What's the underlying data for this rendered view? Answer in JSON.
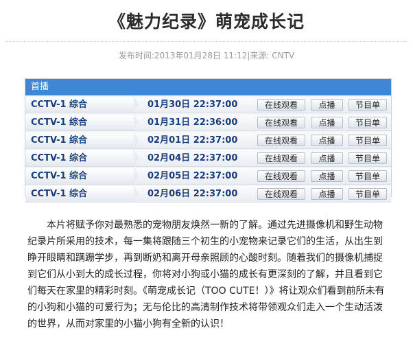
{
  "article": {
    "title": "《魅力纪录》萌宠成长记",
    "meta": "发布时间:2013年01月28日 11:12|来源: CNTV",
    "body": "本片将赋予你对最熟悉的宠物朋友焕然一新的了解。通过先进摄像机和野生动物纪录片所采用的技术，每一集将跟随三个初生的小宠物来记录它们的生活，从出生到睁开眼睛和蹒跚学步，再到断奶和离开母亲照顾的心酸时刻。随着我们的摄像机捕捉到它们从小到大的成长过程，你将对小狗或小猫的成长有更深刻的了解，并且看到它们每天在家里的精彩时刻。《萌宠成长记（TOO CUTE！）》将让观众们看到前所未有的小狗和小猫的可爱行为；无与伦比的高清制作技术将带领观众们走入一个生动活泼的世界，从而对家里的小猫小狗有全新的认识！"
  },
  "schedule": {
    "header": "首播",
    "buttons": {
      "watch": "在线观看",
      "vod": "点播",
      "program": "节目单"
    },
    "rows": [
      {
        "channel": "CCTV-1 综合",
        "time": "01月30日 22:37:00"
      },
      {
        "channel": "CCTV-1 综合",
        "time": "01月31日 22:36:00"
      },
      {
        "channel": "CCTV-1 综合",
        "time": "02月01日 22:37:00"
      },
      {
        "channel": "CCTV-1 综合",
        "time": "02月04日 22:37:00"
      },
      {
        "channel": "CCTV-1 综合",
        "time": "02月05日 22:37:00"
      },
      {
        "channel": "CCTV-1 综合",
        "time": "02月06日 22:37:00"
      }
    ]
  },
  "colors": {
    "header_bg": "#3e87d6",
    "channel_text": "#1b3c78"
  }
}
